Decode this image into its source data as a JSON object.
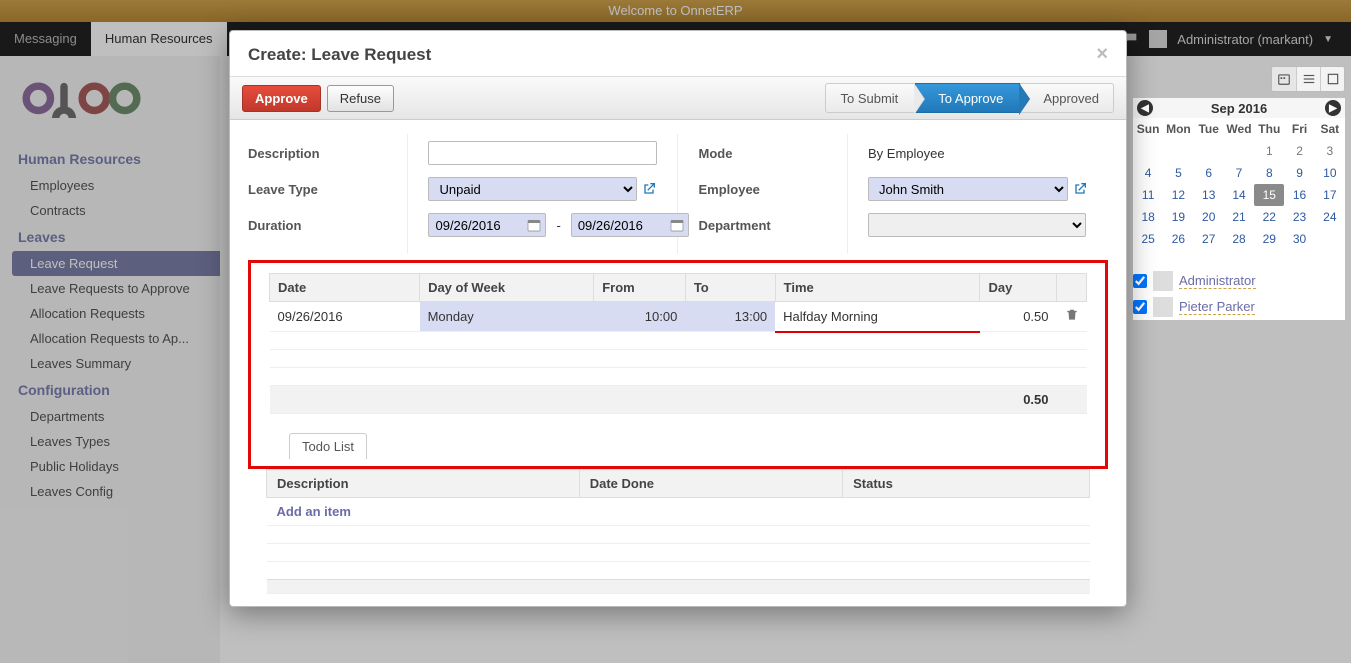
{
  "banner": {
    "text": "Welcome to OnnetERP"
  },
  "menu": {
    "items": [
      "Messaging",
      "Human Resources"
    ],
    "user": "Administrator (markant)"
  },
  "sidebar": {
    "sections": [
      {
        "title": "Human Resources",
        "items": [
          "Employees",
          "Contracts"
        ]
      },
      {
        "title": "Leaves",
        "items": [
          "Leave Request",
          "Leave Requests to Approve",
          "Allocation Requests",
          "Allocation Requests to Ap...",
          "Leaves Summary"
        ],
        "active": "Leave Request"
      },
      {
        "title": "Configuration",
        "items": [
          "Departments",
          "Leaves Types",
          "Public Holidays",
          "Leaves Config"
        ]
      }
    ]
  },
  "modal": {
    "title": "Create: Leave Request",
    "buttons": {
      "approve": "Approve",
      "refuse": "Refuse"
    },
    "workflow": [
      "To Submit",
      "To Approve",
      "Approved"
    ],
    "workflow_active": "To Approve",
    "form": {
      "labels": {
        "description": "Description",
        "leave_type": "Leave Type",
        "duration": "Duration",
        "mode": "Mode",
        "employee": "Employee",
        "department": "Department"
      },
      "values": {
        "description": "",
        "leave_type": "Unpaid",
        "duration_from": "09/26/2016",
        "duration_to": "09/26/2016",
        "mode": "By Employee",
        "employee": "John Smith",
        "department": ""
      }
    },
    "detail_table": {
      "headers": [
        "Date",
        "Day of Week",
        "From",
        "To",
        "Time",
        "Day",
        ""
      ],
      "rows": [
        {
          "date": "09/26/2016",
          "dow": "Monday",
          "from": "10:00",
          "to": "13:00",
          "time": "Halfday Morning",
          "day": "0.50"
        }
      ],
      "total_day": "0.50"
    },
    "todo": {
      "tab": "Todo List",
      "headers": [
        "Description",
        "Date Done",
        "Status"
      ],
      "add": "Add an item"
    }
  },
  "calendar": {
    "month": "Sep 2016",
    "weekdays": [
      "Sun",
      "Mon",
      "Tue",
      "Wed",
      "Thu",
      "Fri",
      "Sat"
    ],
    "selected": 15,
    "lead_blanks": 4,
    "lead_prev": [
      1,
      2,
      3
    ],
    "days": [
      4,
      5,
      6,
      7,
      8,
      9,
      10,
      11,
      12,
      13,
      14,
      15,
      16,
      17,
      18,
      19,
      20,
      21,
      22,
      23,
      24,
      25,
      26,
      27,
      28,
      29,
      30
    ],
    "users": [
      "Administrator",
      "Pieter Parker"
    ]
  }
}
